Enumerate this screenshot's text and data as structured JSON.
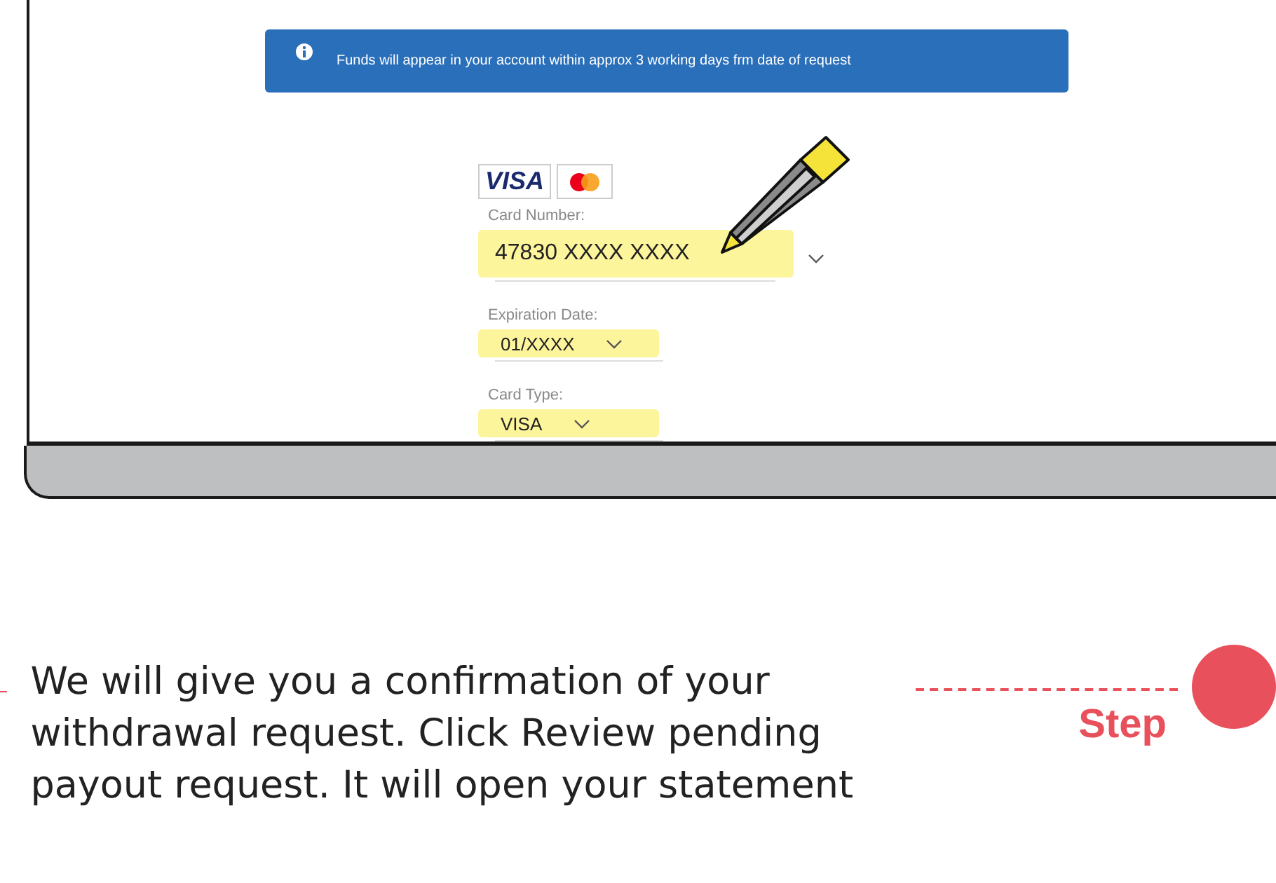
{
  "info_banner": {
    "message": "Funds will appear in your account within approx 3 working days frm date of request"
  },
  "card_logos": [
    {
      "kind": "visa",
      "text": "VISA"
    },
    {
      "kind": "mastercard"
    }
  ],
  "fields": [
    {
      "kind": "wide",
      "label": "Card Number:",
      "value": "47830 XXXX XXXX",
      "highlighted": true
    },
    {
      "kind": "narrow",
      "label": "Expiration Date:",
      "value": "01/XXXX",
      "highlighted": true
    },
    {
      "kind": "narrow",
      "label": "Card Type:",
      "value": "VISA",
      "highlighted": true
    }
  ],
  "instruction": {
    "text": "We will give you a confirmation of your withdrawal request. Click Review pending payout request. It will open your statement",
    "step_label": "Step"
  }
}
